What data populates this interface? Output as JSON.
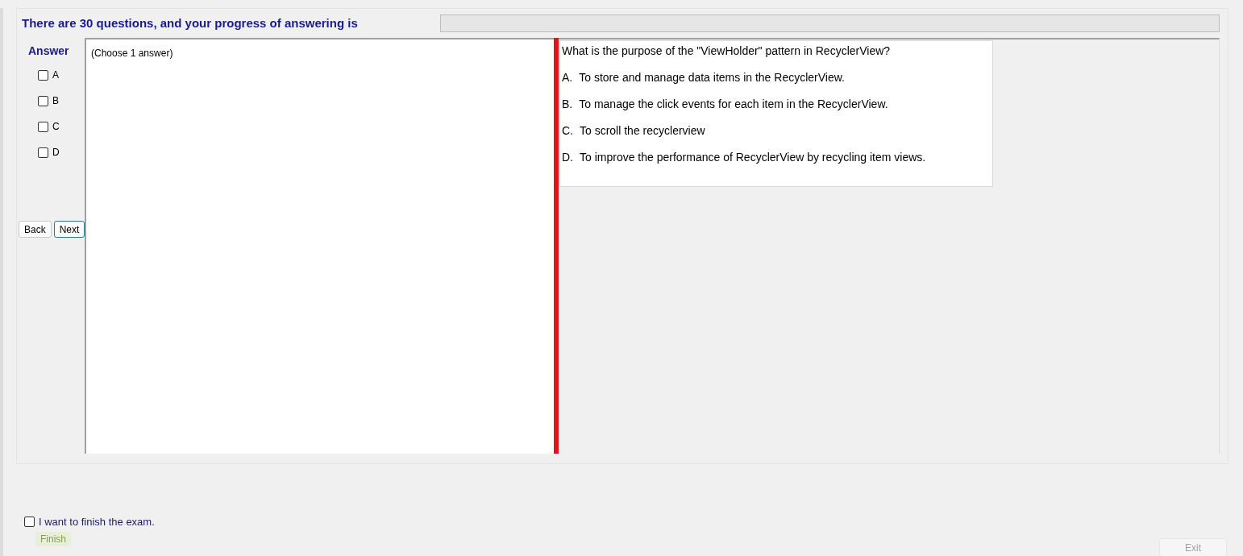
{
  "header": {
    "text": "There are 30 questions, and your progress of answering is",
    "progress": {
      "level": 0
    }
  },
  "answer_panel": {
    "title": "Answer",
    "options": [
      {
        "label": "A",
        "checked": false
      },
      {
        "label": "B",
        "checked": false
      },
      {
        "label": "C",
        "checked": false
      },
      {
        "label": "D",
        "checked": false
      }
    ],
    "buttons": [
      {
        "label": "Back",
        "focused": false
      },
      {
        "label": "Next",
        "focused": true
      }
    ]
  },
  "instruction": "(Choose 1 answer)",
  "question": {
    "text": "What is the purpose of the \"ViewHolder\" pattern in RecyclerView?",
    "choices": [
      {
        "letter": "A.",
        "text": "To store and manage data items in the RecyclerView."
      },
      {
        "letter": "B.",
        "text": "To manage the click events for each item in the RecyclerView."
      },
      {
        "letter": "C.",
        "text": "To scroll the recyclerview"
      },
      {
        "letter": "D.",
        "text": "To improve the performance of RecyclerView by recycling item views."
      }
    ]
  },
  "finish": {
    "label": "I want to finish the exam.",
    "checked": false,
    "button": {
      "label": "Finish",
      "disabled": true
    }
  },
  "exit_button": {
    "label": "Exit",
    "disabled": true
  }
}
